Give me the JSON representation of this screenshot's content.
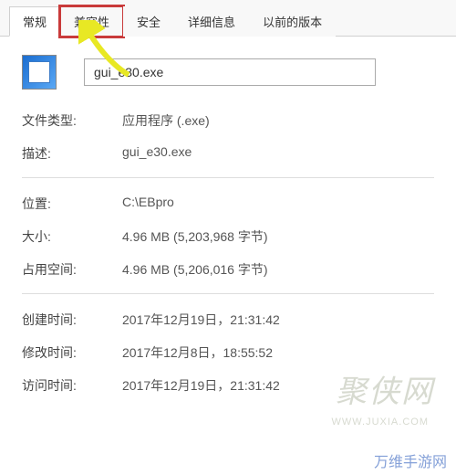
{
  "tabs": [
    {
      "label": "常规",
      "active": true
    },
    {
      "label": "兼容性",
      "active": false,
      "highlighted": true
    },
    {
      "label": "安全",
      "active": false
    },
    {
      "label": "详细信息",
      "active": false
    },
    {
      "label": "以前的版本",
      "active": false
    }
  ],
  "filename": "gui_e30.exe",
  "rows": {
    "file_type": {
      "label": "文件类型:",
      "value": "应用程序 (.exe)"
    },
    "description": {
      "label": "描述:",
      "value": "gui_e30.exe"
    },
    "location": {
      "label": "位置:",
      "value": "C:\\EBpro"
    },
    "size": {
      "label": "大小:",
      "value": "4.96 MB (5,203,968 字节)"
    },
    "size_on_disk": {
      "label": "占用空间:",
      "value": "4.96 MB (5,206,016 字节)"
    },
    "created": {
      "label": "创建时间:",
      "value": "2017年12月19日，21:31:42"
    },
    "modified": {
      "label": "修改时间:",
      "value": "2017年12月8日，18:55:52"
    },
    "accessed": {
      "label": "访问时间:",
      "value": "2017年12月19日，21:31:42"
    }
  },
  "watermarks": {
    "jux": "聚侠网",
    "url": "WWW.JUXIA.COM",
    "wan": "万维手游网"
  }
}
